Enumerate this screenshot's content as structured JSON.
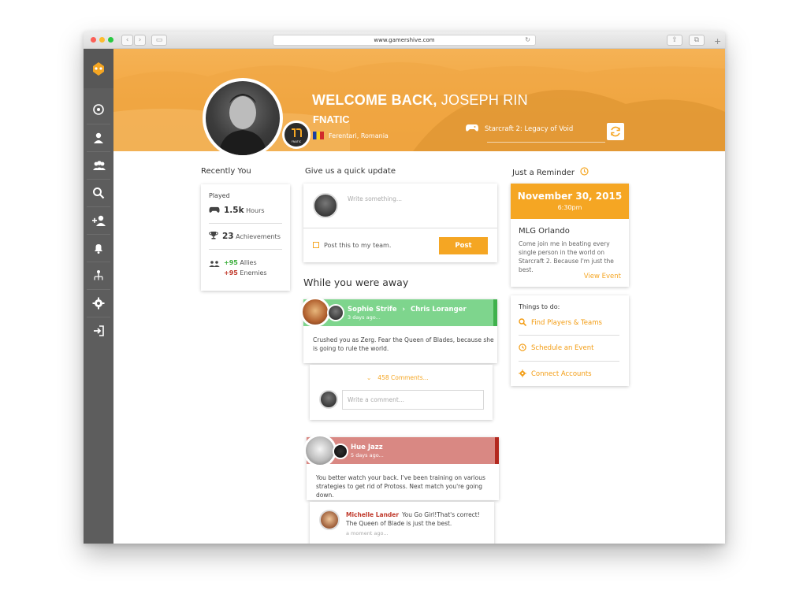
{
  "browser": {
    "url": "www.gamershive.com"
  },
  "header": {
    "welcome_prefix": "WELCOME BACK,",
    "user_name": "JOSEPH RIN",
    "team": "FNATIC",
    "location": "Ferentari, Romania",
    "current_game": "Starcraft 2: Legacy of Void",
    "team_logo_text": "FNATIC"
  },
  "sidebar": {
    "items": [
      "dashboard-icon",
      "profile-icon",
      "team-icon",
      "search-icon",
      "add-user-icon",
      "notifications-icon",
      "hierarchy-icon",
      "settings-icon",
      "logout-icon"
    ]
  },
  "recently": {
    "title": "Recently  You",
    "played_label": "Played",
    "hours_value": "1.5k",
    "hours_label": "Hours",
    "achievements_value": "23",
    "achievements_label": "Achievements",
    "allies_value": "+95",
    "allies_label": "Allies",
    "enemies_value": "+95",
    "enemies_label": "Enemies"
  },
  "update": {
    "title": "Give us a quick update",
    "placeholder": "Write something...",
    "team_checkbox_label": "Post this to my team.",
    "post_label": "Post"
  },
  "away": {
    "title": "While you were away",
    "posts": [
      {
        "author": "Sophie Strife",
        "target": "Chris Loranger",
        "time": "3 days ago...",
        "body": "Crushed you as Zerg. Fear the Queen of Blades, because she is going to rule the world.",
        "comments_label": "458 Comments...",
        "comment_placeholder": "Write a comment..."
      },
      {
        "author": "Hue Jazz",
        "time": "5 days ago...",
        "body": "You better watch your back. I've been training on various strategies to get rid of Protoss. Next match you're going down.",
        "reply_author": "Michelle Lander",
        "reply_text": "You Go Girl!That's correct! The Queen of Blade is just the best.",
        "reply_time": "a moment ago..."
      }
    ]
  },
  "reminder": {
    "title": "Just a Reminder",
    "date": "November 30, 2015",
    "time": "6:30pm",
    "event_name": "MLG Orlando",
    "event_body": "Come join me in beating every single person in the world on Starcraft 2. Because I'm just the best.",
    "view_label": "View Event"
  },
  "todo": {
    "title": "Things to do:",
    "items": [
      "Find Players & Teams",
      "Schedule an Event",
      "Connect Accounts"
    ]
  },
  "colors": {
    "accent": "#f5a623",
    "green_post": "#7ed58d",
    "red_post": "#d98883",
    "sidebar": "#5d5d5d"
  }
}
